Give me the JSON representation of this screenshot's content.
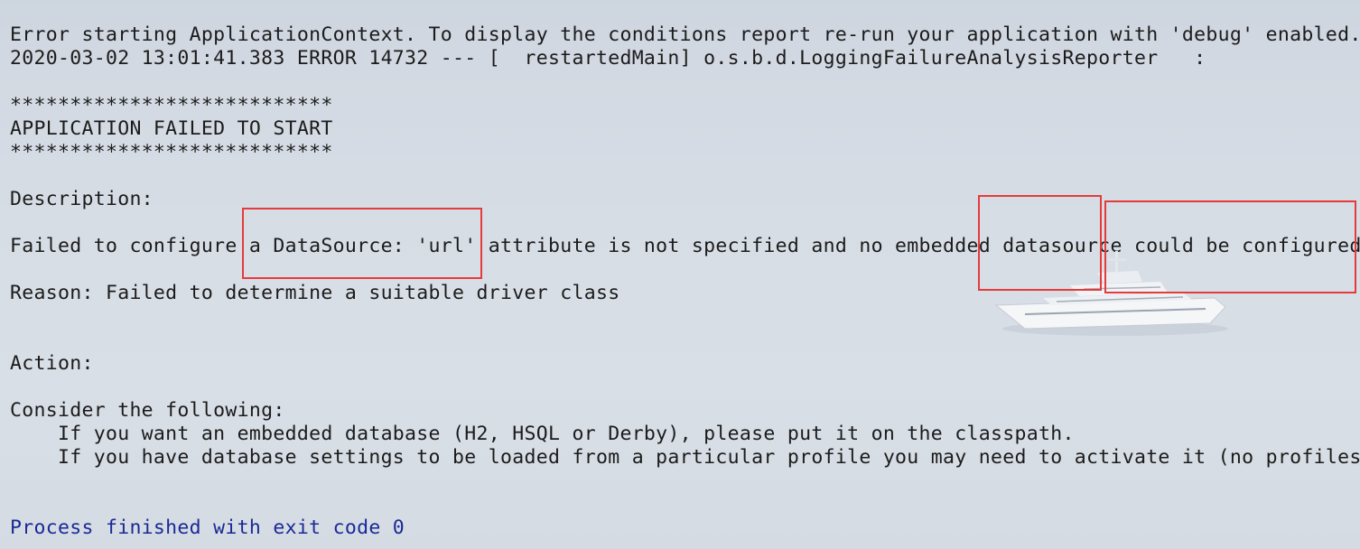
{
  "console": {
    "lines": [
      "Error starting ApplicationContext. To display the conditions report re-run your application with 'debug' enabled.",
      "2020-03-02 13:01:41.383 ERROR 14732 --- [  restartedMain] o.s.b.d.LoggingFailureAnalysisReporter   :",
      "",
      "***************************",
      "APPLICATION FAILED TO START",
      "***************************",
      "",
      "Description:",
      "",
      "Failed to configure a DataSource: 'url' attribute is not specified and no embedded datasource could be configured.",
      "",
      "Reason: Failed to determine a suitable driver class",
      "",
      "",
      "Action:",
      "",
      "Consider the following:",
      "    If you want an embedded database (H2, HSQL or Derby), please put it on the classpath.",
      "    If you have database settings to be loaded from a particular profile you may need to activate it (no profiles a",
      "",
      "",
      "Process finished with exit code 0"
    ]
  },
  "highlight_color": "#e63b3b",
  "process_text_color": "#1a2a95",
  "highlights": [
    {
      "name": "highlight-datasource-url"
    },
    {
      "name": "highlight-datasource-word"
    },
    {
      "name": "highlight-could-be-configured"
    }
  ]
}
